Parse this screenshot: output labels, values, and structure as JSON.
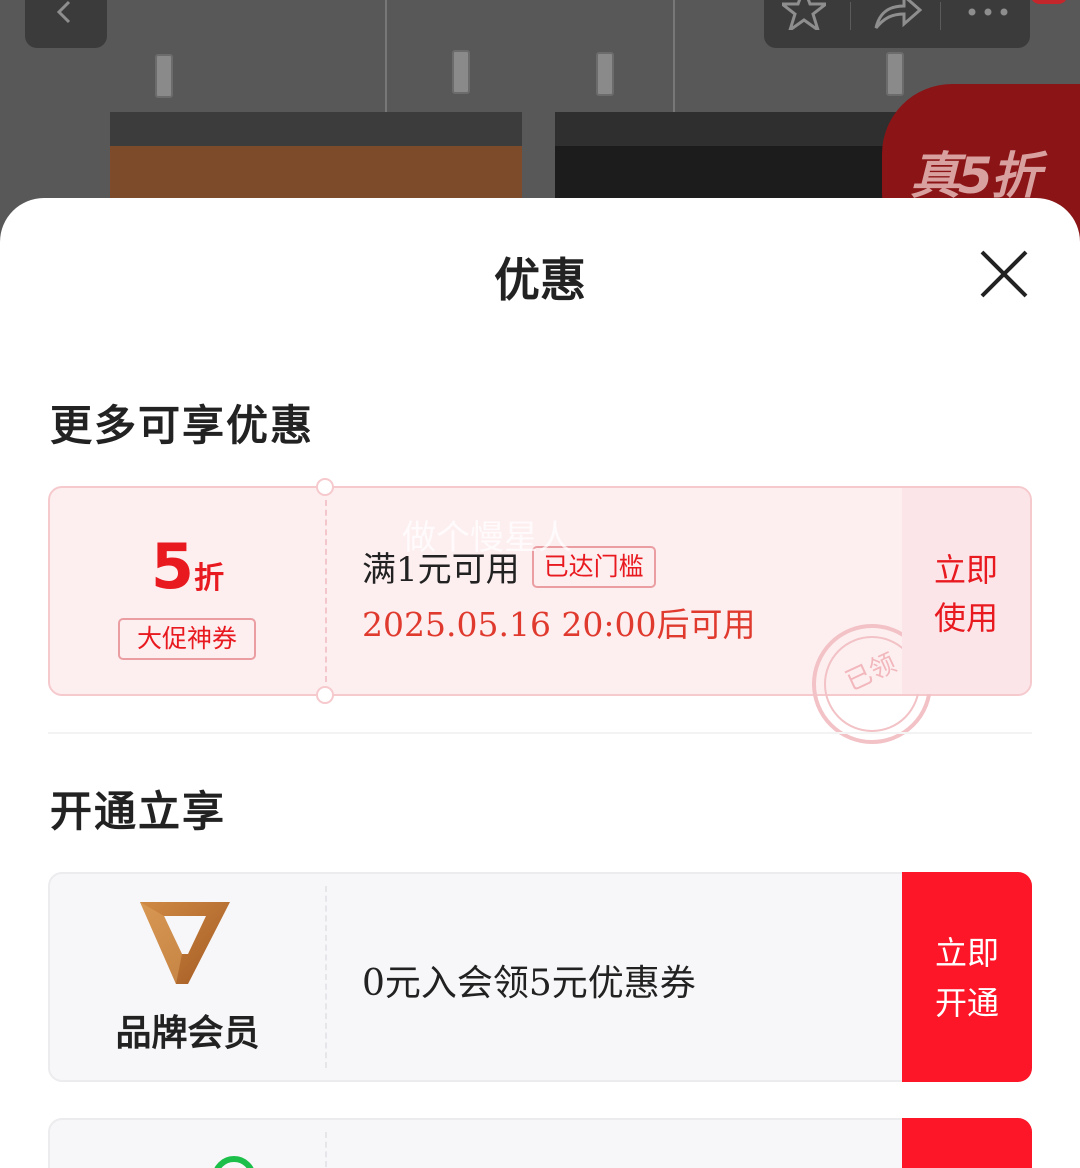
{
  "background": {
    "promo_badge": "真5折"
  },
  "sheet": {
    "title": "优惠",
    "sections": {
      "more_offers_title": "更多可享优惠",
      "open_enjoy_title": "开通立享"
    },
    "coupon": {
      "discount_number": "5",
      "discount_unit": "折",
      "discount_tag": "大促神券",
      "condition": "满1元可用",
      "threshold_tag": "已达门槛",
      "valid_time": "2025.05.16 20:00后可用",
      "use_line1": "立即",
      "use_line2": "使用",
      "stamp": "已领",
      "watermark": "做个慢星人"
    },
    "member": {
      "label": "品牌会员",
      "offer": "0元入会领5元优惠券",
      "open_line1": "立即",
      "open_line2": "开通"
    }
  },
  "colors": {
    "accent_red": "#e8191f",
    "button_red": "#fc1627",
    "coupon_bg": "#fdeff0"
  }
}
